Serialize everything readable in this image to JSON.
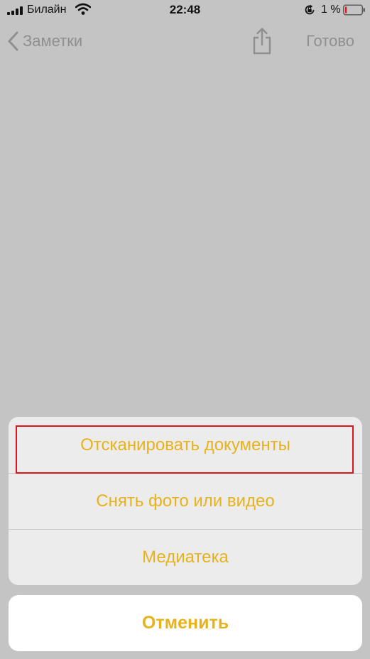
{
  "status_bar": {
    "carrier": "Билайн",
    "time": "22:48",
    "battery_percent": "1 %",
    "icons": [
      "signal-icon",
      "wifi-icon",
      "orientation-lock-icon",
      "battery-icon"
    ]
  },
  "nav_bar": {
    "back_label": "Заметки",
    "done_label": "Готово",
    "share_icon": "share-icon"
  },
  "action_sheet": {
    "options": [
      {
        "label": "Отсканировать документы",
        "highlighted": true
      },
      {
        "label": "Снять фото или видео",
        "highlighted": false
      },
      {
        "label": "Медиатека",
        "highlighted": false
      }
    ],
    "cancel_label": "Отменить"
  },
  "colors": {
    "accent": "#e8b21c",
    "highlight_frame": "#e0131b",
    "dim_background": "#c4c4c4"
  }
}
